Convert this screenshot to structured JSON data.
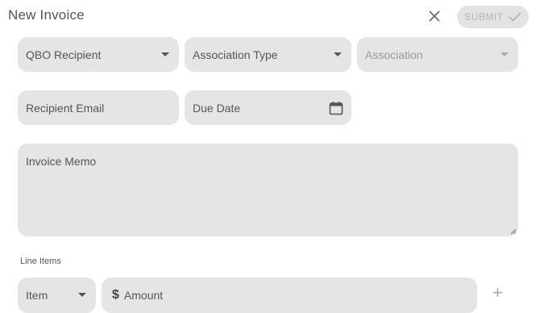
{
  "header": {
    "title": "New Invoice",
    "submit_label": "SUBMIT"
  },
  "form": {
    "qbo_recipient": "QBO Recipient",
    "association_type": "Association Type",
    "association": "Association",
    "recipient_email": "Recipient Email",
    "due_date": "Due Date",
    "invoice_memo": "Invoice Memo"
  },
  "line_items": {
    "heading": "Line Items",
    "item_label": "Item",
    "currency_symbol": "$",
    "amount_label": "Amount",
    "add_symbol": "+"
  },
  "icons": {
    "close": "close-icon",
    "submit": "check-icon",
    "calendar": "calendar-icon",
    "dropdown": "chevron-down-icon"
  },
  "colors": {
    "field_bg": "#e5e5e5",
    "submit_bg": "#e3e3e3",
    "submit_text": "#b3b3b3"
  }
}
